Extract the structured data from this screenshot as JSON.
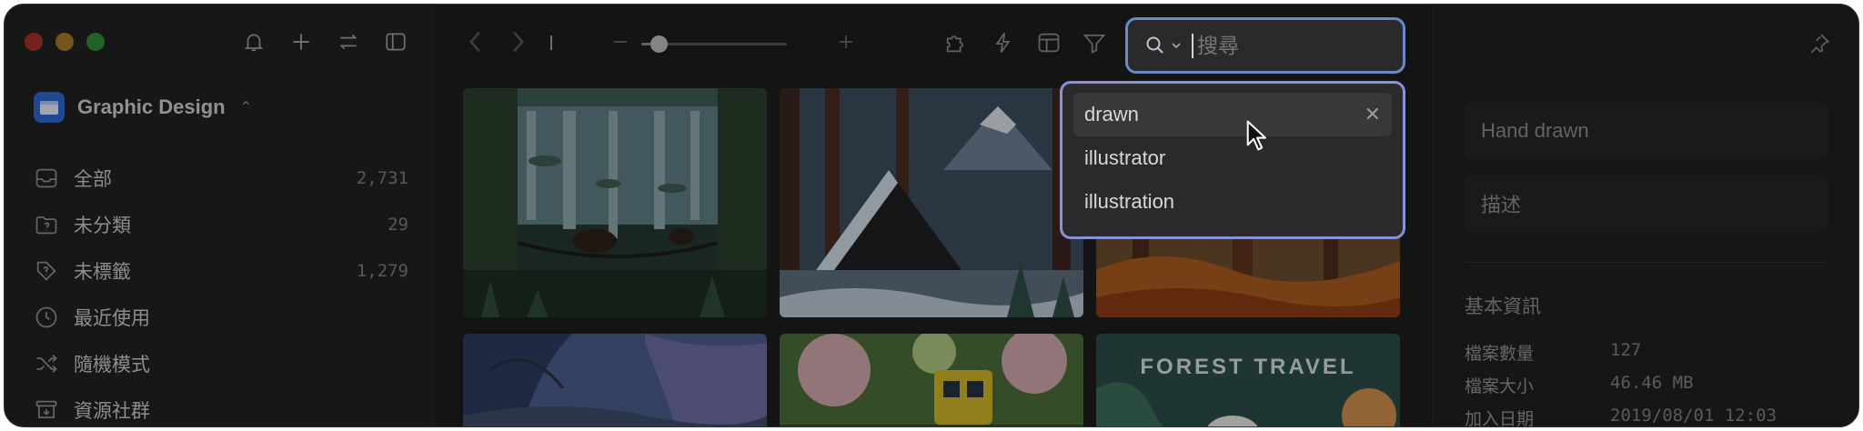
{
  "library": {
    "name": "Graphic Design"
  },
  "sidebar": {
    "items": [
      {
        "label": "全部",
        "count": "2,731",
        "icon": "tray-icon"
      },
      {
        "label": "未分類",
        "count": "29",
        "icon": "folder-question-icon"
      },
      {
        "label": "未標籤",
        "count": "1,279",
        "icon": "tag-question-icon"
      },
      {
        "label": "最近使用",
        "count": "",
        "icon": "clock-icon"
      },
      {
        "label": "隨機模式",
        "count": "",
        "icon": "shuffle-icon"
      },
      {
        "label": "資源社群",
        "count": "",
        "icon": "archive-download-icon"
      }
    ]
  },
  "search": {
    "placeholder": "搜尋",
    "suggestions": [
      "drawn",
      "illustrator",
      "illustration"
    ]
  },
  "zoom": {
    "level": 0.12
  },
  "thumbnails": [
    {
      "label": ""
    },
    {
      "label": ""
    },
    {
      "label": ""
    },
    {
      "label": ""
    },
    {
      "label": ""
    },
    {
      "label": "FOREST TRAVEL"
    }
  ],
  "inspector": {
    "name_value": "Hand drawn",
    "description_placeholder": "描述",
    "section_title": "基本資訊",
    "info": [
      {
        "key": "檔案數量",
        "value": "127"
      },
      {
        "key": "檔案大小",
        "value": "46.46 MB"
      },
      {
        "key": "加入日期",
        "value": "2019/08/01 12:03"
      }
    ]
  },
  "colors": {
    "accent": "#6a89c9",
    "dropdown_border": "#8c90d9",
    "library_icon": "#2f63c8"
  }
}
